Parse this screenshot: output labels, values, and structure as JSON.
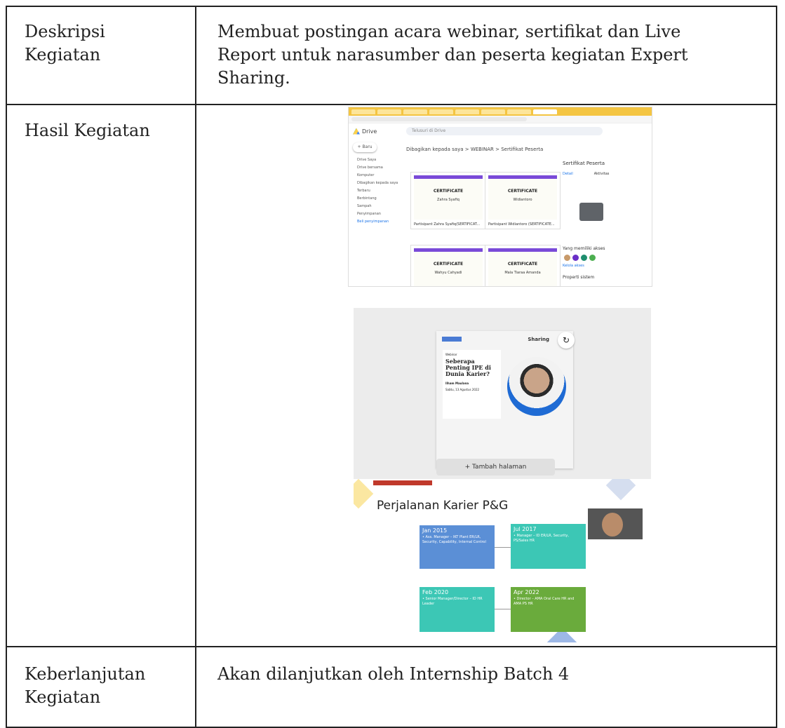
{
  "rows": [
    {
      "label": "Deskripsi Kegiatan",
      "value": "Membuat postingan acara webinar, sertifikat dan Live Report untuk narasumber dan peserta kegiatan Expert Sharing."
    },
    {
      "label": "Hasil Kegiatan",
      "value": ""
    },
    {
      "label": "Keberlanjutan Kegiatan",
      "value": "Akan dilanjutkan oleh Internship Batch 4"
    }
  ],
  "drive": {
    "app": "Drive",
    "search_placeholder": "Telusuri di Drive",
    "new_button": "Baru",
    "sidebar": [
      "Drive Saya",
      "Drive bersama",
      "Komputer",
      "Dibagikan kepada saya",
      "Terbaru",
      "Berbintang",
      "Sampah",
      "Penyimpanan"
    ],
    "buy_storage": "Beli penyimpanan",
    "breadcrumb": "Dibagikan kepada saya  >  WEBINAR  >  Sertifikat Peserta",
    "certificates": [
      {
        "title": "CERTIFICATE",
        "name": "Zahra Syafiq",
        "file": "Partisipant Zahra Syafiq(SERTIFICAT..."
      },
      {
        "title": "CERTIFICATE",
        "name": "Widiantoro",
        "file": "Partisipant Widiantoro (SERTIFICATE..."
      },
      {
        "title": "CERTIFICATE",
        "name": "Wahyu Cahyadi",
        "file": ""
      },
      {
        "title": "CERTIFICATE",
        "name": "Mala Tiaraa Amanda",
        "file": ""
      }
    ],
    "panel_title": "Sertifikat Peserta",
    "panel_tab_detail": "Detail",
    "panel_tab_activity": "Aktivitas",
    "access_label": "Yang memiliki akses",
    "manage_access": "Kelola akses",
    "system_props": "Properti sistem"
  },
  "canva": {
    "brand": "Sharing",
    "poster_eyebrow": "Webinar",
    "poster_title": "Seberapa Penting IPE di Dunia Karier?",
    "speaker_name": "Ilham Maulana",
    "date": "Sabtu, 13 Agustus 2022",
    "add_page": "+ Tambah halaman"
  },
  "slide": {
    "title": "Perjalanan Karier P&G",
    "boxes": [
      {
        "date": "Jan 2015",
        "text": "• Ass. Manager – IKT Plant ER/LR, Security, Capability, Internal Control",
        "color": "#5b8fd6"
      },
      {
        "date": "Jul 2017",
        "text": "• Manager – ID ER/LR, Security, PS/Sales HR",
        "color": "#3cc7b5"
      },
      {
        "date": "Feb 2020",
        "text": "• Senior Manager/Director – ID HR Leader",
        "color": "#3cc7b5"
      },
      {
        "date": "Apr 2022",
        "text": "• Director – AMA Oral Care HR and AMA PS HR",
        "color": "#6aab3c"
      }
    ]
  }
}
